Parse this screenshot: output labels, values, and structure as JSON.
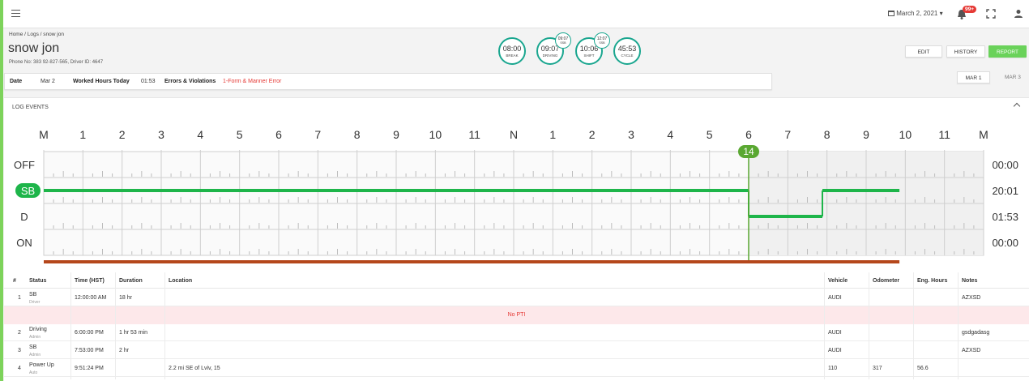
{
  "header": {
    "date": "March 2, 2021",
    "notifications": "99+"
  },
  "breadcrumb": [
    "Home",
    "Logs",
    "snow jon"
  ],
  "driver": {
    "name": "snow jon",
    "details": "Phone No: 383 92-827-565, Driver ID: 4647"
  },
  "gauges": [
    {
      "value": "08:00",
      "label": "BREAK"
    },
    {
      "value": "09:07",
      "label": "DRIVING"
    },
    {
      "value": "10:06",
      "label": "SHIFT"
    },
    {
      "value": "45:53",
      "label": "CYCLE"
    }
  ],
  "mini_gauges": [
    {
      "value": "09:07",
      "label": "SSB"
    },
    {
      "value": "12:07",
      "label": "SSB"
    }
  ],
  "buttons": {
    "edit": "EDIT",
    "history": "HISTORY",
    "report": "REPORT"
  },
  "info": {
    "date_label": "Date",
    "date_value": "Mar 2",
    "worked_label": "Worked Hours Today",
    "worked_value": "01:53",
    "errors_label": "Errors & Violations",
    "errors_value": "1-Form & Manner Error"
  },
  "day_nav": {
    "current": "MAR 1",
    "next": "MAR 3"
  },
  "log_events": {
    "title": "LOG EVENTS",
    "hour_labels": [
      "M",
      "1",
      "2",
      "3",
      "4",
      "5",
      "6",
      "7",
      "8",
      "9",
      "10",
      "11",
      "N",
      "1",
      "2",
      "3",
      "4",
      "5",
      "6",
      "7",
      "8",
      "9",
      "10",
      "11",
      "M"
    ],
    "statuses": [
      "OFF",
      "SB",
      "D",
      "ON"
    ],
    "active_status": "SB",
    "totals": [
      "00:00",
      "20:01",
      "01:53",
      "00:00"
    ],
    "cursor_label": "14"
  },
  "chart_data": {
    "type": "line",
    "x_unit": "hour of day",
    "xlim": [
      0,
      24
    ],
    "rows": [
      "OFF",
      "SB",
      "D",
      "ON"
    ],
    "segments": [
      {
        "status": "SB",
        "start": 0,
        "end": 18
      },
      {
        "status": "D",
        "start": 18,
        "end": 19.883
      },
      {
        "status": "SB",
        "start": 19.883,
        "end": 21.85
      }
    ],
    "totals": {
      "OFF": "00:00",
      "SB": "20:01",
      "D": "01:53",
      "ON": "00:00"
    },
    "cursor": {
      "x": 18,
      "label": "14"
    },
    "colors": {
      "line": "#1eb54a",
      "cursor": "#5aa832",
      "bar": "#b5471b"
    }
  },
  "table": {
    "headers": [
      "#",
      "Status",
      "Time (HST)",
      "Duration",
      "Location",
      "Vehicle",
      "Odometer",
      "Eng. Hours",
      "Notes"
    ],
    "rows": [
      {
        "num": "1",
        "status": "SB",
        "source": "Driver",
        "time": "12:00:00 AM",
        "duration": "18 hr",
        "location": "",
        "vehicle": "AUDI",
        "odometer": "",
        "eng_hours": "",
        "notes": "AZXSD"
      },
      {
        "num": "2",
        "status": "Driving",
        "source": "Admin",
        "time": "6:00:00 PM",
        "duration": "1 hr 53 min",
        "location": "",
        "vehicle": "AUDI",
        "odometer": "",
        "eng_hours": "",
        "notes": "gsdgadasg"
      },
      {
        "num": "3",
        "status": "SB",
        "source": "Admin",
        "time": "7:53:00 PM",
        "duration": "2 hr",
        "location": "",
        "vehicle": "AUDI",
        "odometer": "",
        "eng_hours": "",
        "notes": "AZXSD"
      },
      {
        "num": "4",
        "status": "Power Up",
        "source": "Auto",
        "time": "9:51:24 PM",
        "duration": "",
        "location": "2.2 mi SE of Lviv, 15",
        "vehicle": "110",
        "odometer": "317",
        "eng_hours": "56.6",
        "notes": ""
      }
    ],
    "alert": "No PTI"
  },
  "colors": {
    "accent": "#6ad25a",
    "teal": "#1aa68f",
    "error": "#e53935"
  }
}
